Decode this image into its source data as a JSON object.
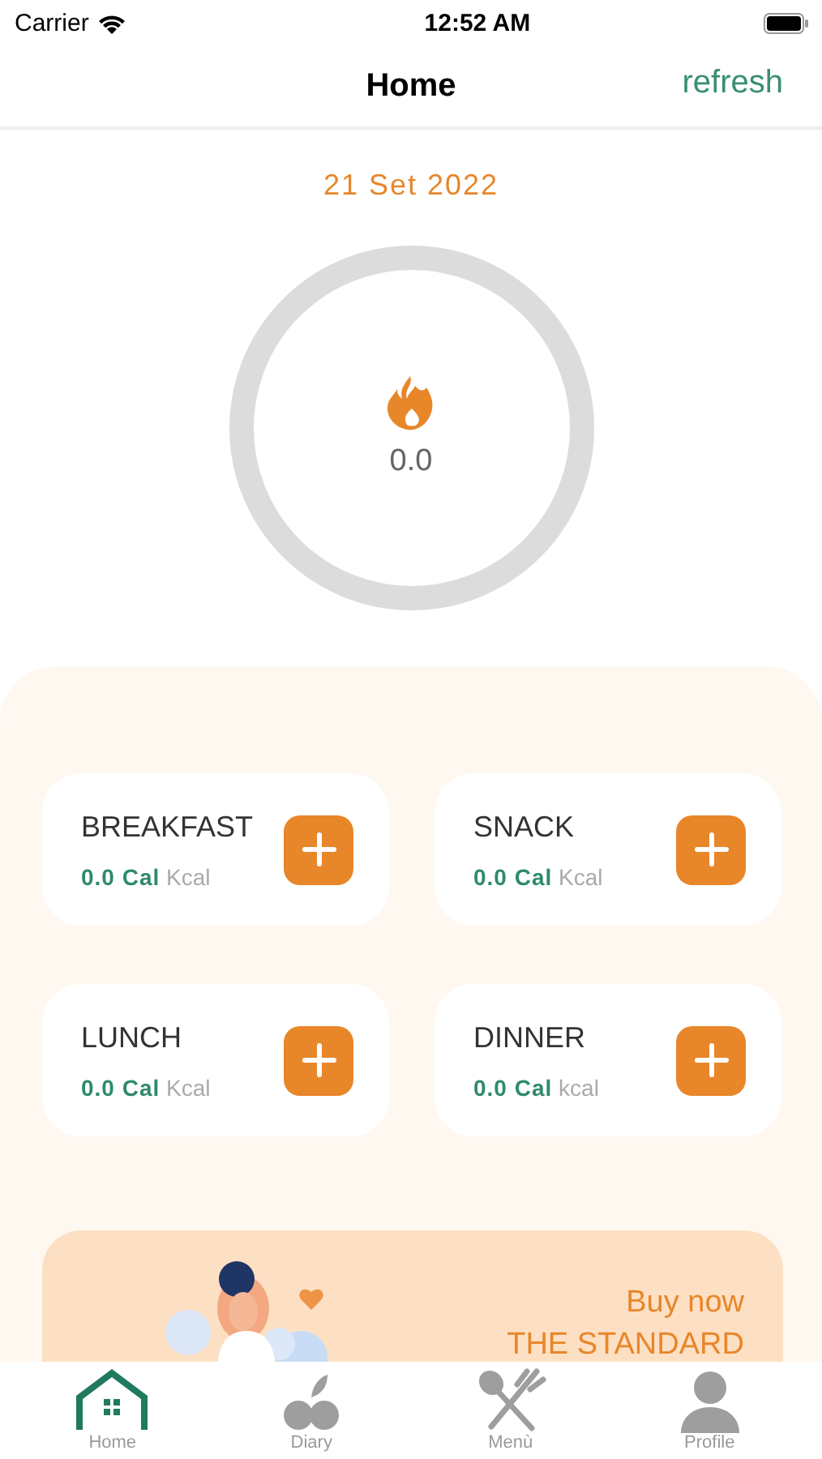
{
  "status_bar": {
    "carrier": "Carrier",
    "time": "12:52 AM"
  },
  "nav": {
    "title": "Home",
    "action": "refresh"
  },
  "date": "21 Set 2022",
  "calories": {
    "value": "0.0",
    "level": 0
  },
  "meals": [
    {
      "name": "BREAKFAST",
      "amount": "0.0 Cal",
      "unit": "Kcal"
    },
    {
      "name": "SNACK",
      "amount": "0.0 Cal",
      "unit": "Kcal"
    },
    {
      "name": "LUNCH",
      "amount": "0.0 Cal",
      "unit": "Kcal"
    },
    {
      "name": "DINNER",
      "amount": "0.0 Cal",
      "unit": "kcal"
    }
  ],
  "banner": {
    "kind": "picture",
    "line_1": "Buy now",
    "line_2": "THE STANDARD"
  },
  "tabs": [
    {
      "label": "Home",
      "kind": "home",
      "selected": true
    },
    {
      "label": "Diary",
      "kind": "diary",
      "selected": false
    },
    {
      "label": "Menù",
      "kind": "menu",
      "selected": false
    },
    {
      "label": "Profile",
      "kind": "profile",
      "selected": false
    }
  ]
}
